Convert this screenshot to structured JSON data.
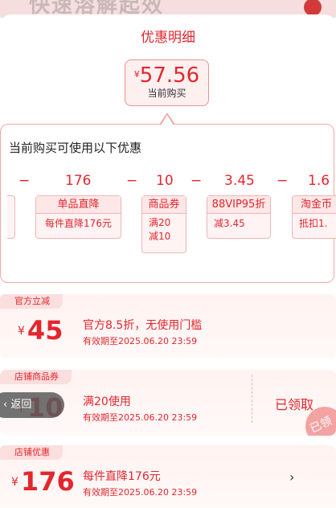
{
  "background": {
    "banner_text": "快速溶解起效",
    "chart_icon": "bar-chart-icon"
  },
  "title": "优惠明细",
  "price": {
    "currency": "¥",
    "amount": "57.56",
    "caption": "当前购买"
  },
  "card": {
    "heading": "当前购买可使用以下优惠",
    "equation": [
      {
        "op": "−",
        "value": "176"
      },
      {
        "op": "−",
        "value": "10"
      },
      {
        "op": "−",
        "value": "3.45"
      },
      {
        "op": "−",
        "value": "1.6"
      }
    ],
    "chips": [
      {
        "label": "单品直降",
        "desc": "每件直降176元"
      },
      {
        "label": "商品券",
        "desc": "满20减10"
      },
      {
        "label": "88VIP95折",
        "desc": "减3.45"
      },
      {
        "label": "淘金币",
        "desc": "抵扣1."
      }
    ]
  },
  "sections": [
    {
      "tag": "官方立减",
      "currency": "¥",
      "amount": "45",
      "line1": "官方8.5折，无使用门槛",
      "line2": "有效期至2025.06.20 23:59"
    },
    {
      "tag": "店铺商品券",
      "currency": "¥",
      "amount": "10",
      "line1": "满20使用",
      "line2": "有效期至2025.06.20 23:59",
      "status": "已领取",
      "stamp": "已领"
    },
    {
      "tag": "店铺优惠",
      "currency": "¥",
      "amount": "176",
      "line1": "每件直降176元",
      "line2": "有效期至2025.06.20 23:59"
    }
  ],
  "back_button": "返回",
  "colors": {
    "accent": "#e3262e",
    "tag_bg": "#fbdede",
    "section_bg": "#fff3f1"
  }
}
